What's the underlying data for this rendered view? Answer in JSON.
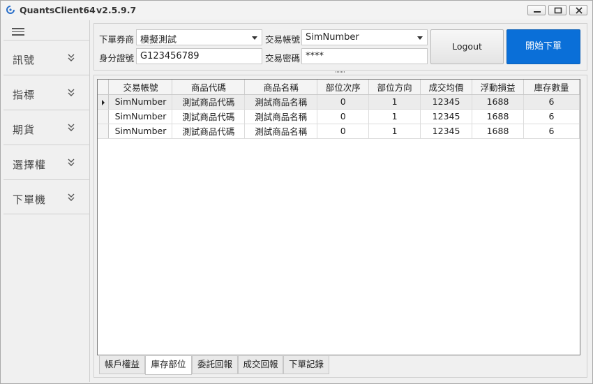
{
  "window": {
    "title": "QuantsClient64",
    "version": "v2.5.9.7"
  },
  "sidebar": {
    "items": [
      {
        "label": "訊號"
      },
      {
        "label": "指標"
      },
      {
        "label": "期貨"
      },
      {
        "label": "選擇權"
      },
      {
        "label": "下單機"
      }
    ]
  },
  "form": {
    "broker_label": "下單券商",
    "broker_value": "模擬測試",
    "account_label": "交易帳號",
    "account_value": "SimNumber",
    "id_label": "身分證號",
    "id_value": "G123456789",
    "password_label": "交易密碼",
    "password_value": "****",
    "logout_label": "Logout",
    "start_label": "開始下單"
  },
  "grid": {
    "columns": [
      "交易帳號",
      "商品代碼",
      "商品名稱",
      "部位次序",
      "部位方向",
      "成交均價",
      "浮動損益",
      "庫存數量"
    ],
    "rows": [
      [
        "SimNumber",
        "測試商品代碼",
        "測試商品名稱",
        "0",
        "1",
        "12345",
        "1688",
        "6"
      ],
      [
        "SimNumber",
        "測試商品代碼",
        "測試商品名稱",
        "0",
        "1",
        "12345",
        "1688",
        "6"
      ],
      [
        "SimNumber",
        "測試商品代碼",
        "測試商品名稱",
        "0",
        "1",
        "12345",
        "1688",
        "6"
      ]
    ]
  },
  "tabs": [
    {
      "label": "帳戶權益"
    },
    {
      "label": "庫存部位"
    },
    {
      "label": "委託回報"
    },
    {
      "label": "成交回報"
    },
    {
      "label": "下單記錄"
    }
  ],
  "colors": {
    "accent": "#0a6fd8",
    "background": "#f0f0f0"
  }
}
